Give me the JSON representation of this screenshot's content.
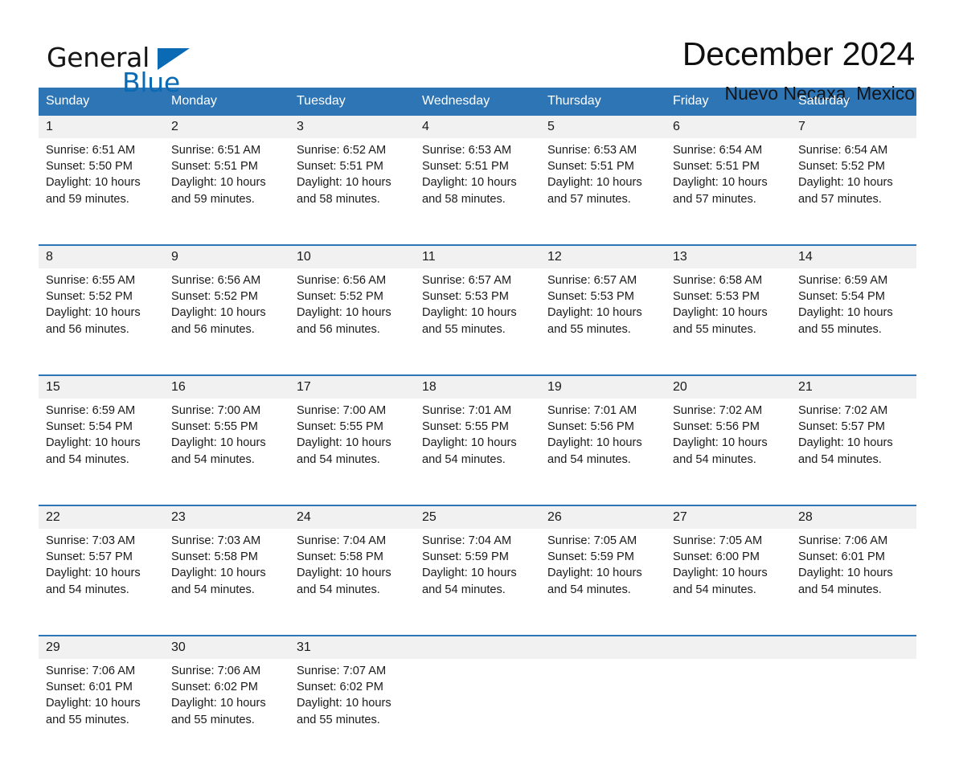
{
  "brand": {
    "logo_word_1": "General",
    "logo_word_2": "Blue",
    "logo_triangle_color": "#0a6ab4"
  },
  "header": {
    "title": "December 2024",
    "subtitle": "Nuevo Necaxa, Mexico"
  },
  "theme": {
    "header_blue": "#2e75b6",
    "daynum_band": "#f1f1f1",
    "text": "#1a1a1a",
    "page_background": "#ffffff"
  },
  "calendar": {
    "weekday_headers": [
      "Sunday",
      "Monday",
      "Tuesday",
      "Wednesday",
      "Thursday",
      "Friday",
      "Saturday"
    ],
    "weeks": [
      {
        "days": [
          {
            "date": "1",
            "sunrise": "Sunrise: 6:51 AM",
            "sunset": "Sunset: 5:50 PM",
            "daylight_line1": "Daylight: 10 hours",
            "daylight_line2": "and 59 minutes."
          },
          {
            "date": "2",
            "sunrise": "Sunrise: 6:51 AM",
            "sunset": "Sunset: 5:51 PM",
            "daylight_line1": "Daylight: 10 hours",
            "daylight_line2": "and 59 minutes."
          },
          {
            "date": "3",
            "sunrise": "Sunrise: 6:52 AM",
            "sunset": "Sunset: 5:51 PM",
            "daylight_line1": "Daylight: 10 hours",
            "daylight_line2": "and 58 minutes."
          },
          {
            "date": "4",
            "sunrise": "Sunrise: 6:53 AM",
            "sunset": "Sunset: 5:51 PM",
            "daylight_line1": "Daylight: 10 hours",
            "daylight_line2": "and 58 minutes."
          },
          {
            "date": "5",
            "sunrise": "Sunrise: 6:53 AM",
            "sunset": "Sunset: 5:51 PM",
            "daylight_line1": "Daylight: 10 hours",
            "daylight_line2": "and 57 minutes."
          },
          {
            "date": "6",
            "sunrise": "Sunrise: 6:54 AM",
            "sunset": "Sunset: 5:51 PM",
            "daylight_line1": "Daylight: 10 hours",
            "daylight_line2": "and 57 minutes."
          },
          {
            "date": "7",
            "sunrise": "Sunrise: 6:54 AM",
            "sunset": "Sunset: 5:52 PM",
            "daylight_line1": "Daylight: 10 hours",
            "daylight_line2": "and 57 minutes."
          }
        ]
      },
      {
        "days": [
          {
            "date": "8",
            "sunrise": "Sunrise: 6:55 AM",
            "sunset": "Sunset: 5:52 PM",
            "daylight_line1": "Daylight: 10 hours",
            "daylight_line2": "and 56 minutes."
          },
          {
            "date": "9",
            "sunrise": "Sunrise: 6:56 AM",
            "sunset": "Sunset: 5:52 PM",
            "daylight_line1": "Daylight: 10 hours",
            "daylight_line2": "and 56 minutes."
          },
          {
            "date": "10",
            "sunrise": "Sunrise: 6:56 AM",
            "sunset": "Sunset: 5:52 PM",
            "daylight_line1": "Daylight: 10 hours",
            "daylight_line2": "and 56 minutes."
          },
          {
            "date": "11",
            "sunrise": "Sunrise: 6:57 AM",
            "sunset": "Sunset: 5:53 PM",
            "daylight_line1": "Daylight: 10 hours",
            "daylight_line2": "and 55 minutes."
          },
          {
            "date": "12",
            "sunrise": "Sunrise: 6:57 AM",
            "sunset": "Sunset: 5:53 PM",
            "daylight_line1": "Daylight: 10 hours",
            "daylight_line2": "and 55 minutes."
          },
          {
            "date": "13",
            "sunrise": "Sunrise: 6:58 AM",
            "sunset": "Sunset: 5:53 PM",
            "daylight_line1": "Daylight: 10 hours",
            "daylight_line2": "and 55 minutes."
          },
          {
            "date": "14",
            "sunrise": "Sunrise: 6:59 AM",
            "sunset": "Sunset: 5:54 PM",
            "daylight_line1": "Daylight: 10 hours",
            "daylight_line2": "and 55 minutes."
          }
        ]
      },
      {
        "days": [
          {
            "date": "15",
            "sunrise": "Sunrise: 6:59 AM",
            "sunset": "Sunset: 5:54 PM",
            "daylight_line1": "Daylight: 10 hours",
            "daylight_line2": "and 54 minutes."
          },
          {
            "date": "16",
            "sunrise": "Sunrise: 7:00 AM",
            "sunset": "Sunset: 5:55 PM",
            "daylight_line1": "Daylight: 10 hours",
            "daylight_line2": "and 54 minutes."
          },
          {
            "date": "17",
            "sunrise": "Sunrise: 7:00 AM",
            "sunset": "Sunset: 5:55 PM",
            "daylight_line1": "Daylight: 10 hours",
            "daylight_line2": "and 54 minutes."
          },
          {
            "date": "18",
            "sunrise": "Sunrise: 7:01 AM",
            "sunset": "Sunset: 5:55 PM",
            "daylight_line1": "Daylight: 10 hours",
            "daylight_line2": "and 54 minutes."
          },
          {
            "date": "19",
            "sunrise": "Sunrise: 7:01 AM",
            "sunset": "Sunset: 5:56 PM",
            "daylight_line1": "Daylight: 10 hours",
            "daylight_line2": "and 54 minutes."
          },
          {
            "date": "20",
            "sunrise": "Sunrise: 7:02 AM",
            "sunset": "Sunset: 5:56 PM",
            "daylight_line1": "Daylight: 10 hours",
            "daylight_line2": "and 54 minutes."
          },
          {
            "date": "21",
            "sunrise": "Sunrise: 7:02 AM",
            "sunset": "Sunset: 5:57 PM",
            "daylight_line1": "Daylight: 10 hours",
            "daylight_line2": "and 54 minutes."
          }
        ]
      },
      {
        "days": [
          {
            "date": "22",
            "sunrise": "Sunrise: 7:03 AM",
            "sunset": "Sunset: 5:57 PM",
            "daylight_line1": "Daylight: 10 hours",
            "daylight_line2": "and 54 minutes."
          },
          {
            "date": "23",
            "sunrise": "Sunrise: 7:03 AM",
            "sunset": "Sunset: 5:58 PM",
            "daylight_line1": "Daylight: 10 hours",
            "daylight_line2": "and 54 minutes."
          },
          {
            "date": "24",
            "sunrise": "Sunrise: 7:04 AM",
            "sunset": "Sunset: 5:58 PM",
            "daylight_line1": "Daylight: 10 hours",
            "daylight_line2": "and 54 minutes."
          },
          {
            "date": "25",
            "sunrise": "Sunrise: 7:04 AM",
            "sunset": "Sunset: 5:59 PM",
            "daylight_line1": "Daylight: 10 hours",
            "daylight_line2": "and 54 minutes."
          },
          {
            "date": "26",
            "sunrise": "Sunrise: 7:05 AM",
            "sunset": "Sunset: 5:59 PM",
            "daylight_line1": "Daylight: 10 hours",
            "daylight_line2": "and 54 minutes."
          },
          {
            "date": "27",
            "sunrise": "Sunrise: 7:05 AM",
            "sunset": "Sunset: 6:00 PM",
            "daylight_line1": "Daylight: 10 hours",
            "daylight_line2": "and 54 minutes."
          },
          {
            "date": "28",
            "sunrise": "Sunrise: 7:06 AM",
            "sunset": "Sunset: 6:01 PM",
            "daylight_line1": "Daylight: 10 hours",
            "daylight_line2": "and 54 minutes."
          }
        ]
      },
      {
        "days": [
          {
            "date": "29",
            "sunrise": "Sunrise: 7:06 AM",
            "sunset": "Sunset: 6:01 PM",
            "daylight_line1": "Daylight: 10 hours",
            "daylight_line2": "and 55 minutes."
          },
          {
            "date": "30",
            "sunrise": "Sunrise: 7:06 AM",
            "sunset": "Sunset: 6:02 PM",
            "daylight_line1": "Daylight: 10 hours",
            "daylight_line2": "and 55 minutes."
          },
          {
            "date": "31",
            "sunrise": "Sunrise: 7:07 AM",
            "sunset": "Sunset: 6:02 PM",
            "daylight_line1": "Daylight: 10 hours",
            "daylight_line2": "and 55 minutes."
          },
          {
            "date": "",
            "sunrise": "",
            "sunset": "",
            "daylight_line1": "",
            "daylight_line2": ""
          },
          {
            "date": "",
            "sunrise": "",
            "sunset": "",
            "daylight_line1": "",
            "daylight_line2": ""
          },
          {
            "date": "",
            "sunrise": "",
            "sunset": "",
            "daylight_line1": "",
            "daylight_line2": ""
          },
          {
            "date": "",
            "sunrise": "",
            "sunset": "",
            "daylight_line1": "",
            "daylight_line2": ""
          }
        ]
      }
    ]
  }
}
